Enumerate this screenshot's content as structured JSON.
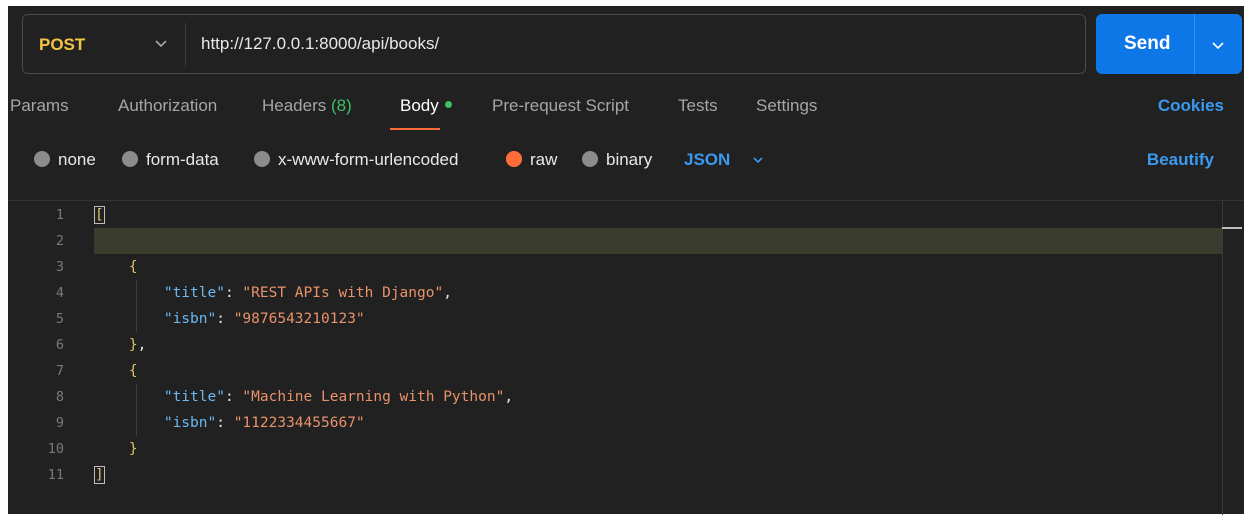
{
  "request": {
    "method": "POST",
    "url": "http://127.0.0.1:8000/api/books/",
    "send_label": "Send"
  },
  "tabs": [
    {
      "label": "Params"
    },
    {
      "label": "Authorization"
    },
    {
      "label": "Headers",
      "count": "(8)"
    },
    {
      "label": "Body",
      "active": true
    },
    {
      "label": "Pre-request Script"
    },
    {
      "label": "Tests"
    },
    {
      "label": "Settings"
    }
  ],
  "cookies_label": "Cookies",
  "body_types": [
    {
      "label": "none"
    },
    {
      "label": "form-data"
    },
    {
      "label": "x-www-form-urlencoded"
    },
    {
      "label": "raw",
      "selected": true
    },
    {
      "label": "binary"
    }
  ],
  "format": "JSON",
  "beautify_label": "Beautify",
  "editor": {
    "line_numbers": [
      "1",
      "2",
      "3",
      "4",
      "5",
      "6",
      "7",
      "8",
      "9",
      "10",
      "11"
    ],
    "books": [
      {
        "title_key": "\"title\"",
        "title": "\"REST APIs with Django\"",
        "isbn_key": "\"isbn\"",
        "isbn": "\"9876543210123\""
      },
      {
        "title_key": "\"title\"",
        "title": "\"Machine Learning with Python\"",
        "isbn_key": "\"isbn\"",
        "isbn": "\"1122334455667\""
      }
    ],
    "open_bracket": "[",
    "close_bracket": "]",
    "open_brace": "{",
    "close_brace": "}",
    "comma": ","
  },
  "colors": {
    "method": "#f6c244",
    "send": "#0d77e8",
    "accent": "#ff6c37",
    "link": "#3a9af0",
    "key": "#6bb9f0",
    "string": "#e8926a",
    "headers_count": "#3dbf62"
  }
}
